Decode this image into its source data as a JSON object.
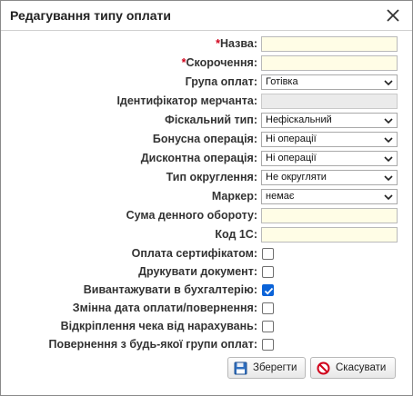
{
  "dialog": {
    "title": "Редагування типу оплати"
  },
  "fields": {
    "name": {
      "label": "Назва:",
      "required_mark": "*",
      "value": ""
    },
    "short": {
      "label": "Скорочення:",
      "required_mark": "*",
      "value": ""
    },
    "group": {
      "label": "Група оплат:",
      "value": "Готівка"
    },
    "merchant": {
      "label": "Ідентифікатор мерчанта:",
      "value": ""
    },
    "fiscal": {
      "label": "Фіскальний тип:",
      "value": "Нефіскальний"
    },
    "bonus": {
      "label": "Бонусна операція:",
      "value": "Ні операції"
    },
    "discount": {
      "label": "Дисконтна операція:",
      "value": "Ні операції"
    },
    "rounding": {
      "label": "Тип округлення:",
      "value": "Не округляти"
    },
    "marker": {
      "label": "Маркер:",
      "value": "немає"
    },
    "daily_turnover": {
      "label": "Сума денного обороту:",
      "value": ""
    },
    "code_1c": {
      "label": "Код 1С:",
      "value": ""
    }
  },
  "checkboxes": [
    {
      "label": "Оплата сертифікатом:",
      "checked": false
    },
    {
      "label": "Друкувати документ:",
      "checked": false
    },
    {
      "label": "Вивантажувати в бухгалтерію:",
      "checked": true
    },
    {
      "label": "Змінна дата оплати/повернення:",
      "checked": false
    },
    {
      "label": "Відкріплення чека від нарахувань:",
      "checked": false
    },
    {
      "label": "Повернення з будь-якої групи оплат:",
      "checked": false
    }
  ],
  "buttons": {
    "save_label": "Зберегти",
    "cancel_label": "Скасувати"
  },
  "icons": {
    "close": "close-icon",
    "save": "floppy-disk-icon",
    "cancel": "no-entry-icon",
    "dropdown": "chevron-down-icon",
    "check": "check-icon"
  },
  "colors": {
    "accent": "#0a63d8",
    "required": "#d0021b",
    "input_bg": "#fffde6",
    "disabled_bg": "#ebebeb"
  }
}
